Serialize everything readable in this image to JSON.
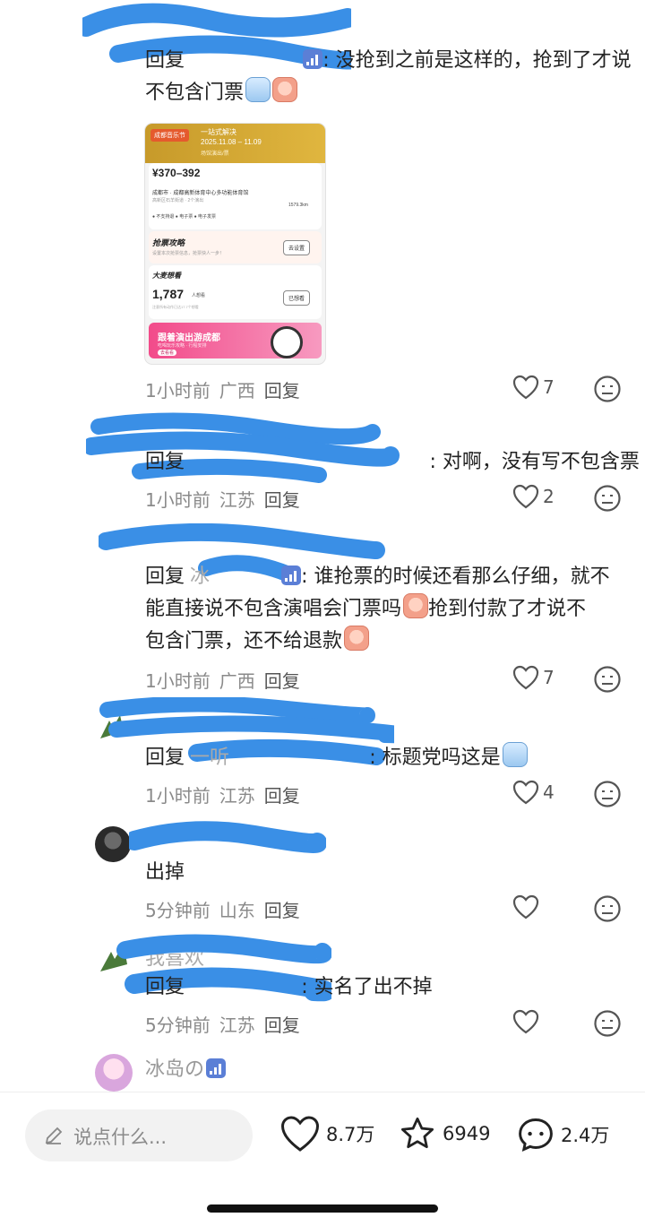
{
  "comments": [
    {
      "reply_prefix": "回复",
      "text": ": 没抢到之前是这样的，抢到了才说",
      "text2": "不包含门票",
      "time": "1小时前",
      "location": "广西",
      "reply_label": "回复",
      "likes": "7"
    },
    {
      "reply_prefix": "回复",
      "text": ": 对啊，没有写不包含票",
      "time": "1小时前",
      "location": "江苏",
      "reply_label": "回复",
      "likes": "2"
    },
    {
      "reply_prefix": "回复",
      "name_partial": "冰",
      "text": ": 谁抢票的时候还看那么仔细，就不",
      "text2": "能直接说不包含演唱会门票吗",
      "text2b": "抢到付款了才说不",
      "text3": "包含门票，还不给退款",
      "time": "1小时前",
      "location": "广西",
      "reply_label": "回复",
      "likes": "7"
    },
    {
      "reply_prefix": "回复",
      "name_partial": "一听",
      "text": ": 标题党吗这是",
      "time": "1小时前",
      "location": "江苏",
      "reply_label": "回复",
      "likes": "4"
    },
    {
      "text": "出掉",
      "time": "5分钟前",
      "location": "山东",
      "reply_label": "回复",
      "likes": ""
    },
    {
      "username_partial": "我喜欢",
      "reply_prefix": "回复",
      "text": ": 实名了出不掉",
      "time": "5分钟前",
      "location": "江苏",
      "reply_label": "回复",
      "likes": ""
    }
  ],
  "last_user": {
    "name": "冰岛の"
  },
  "ticket_card": {
    "logo": "成都音乐节",
    "headline": "一站式解决",
    "dates": "2025.11.08 – 11.09",
    "subline": "场馆演出/票",
    "price": "¥370–392",
    "venue": "成都市 · 成都高新体育中心多功能体育馆",
    "venue_sub": "高新区石羊街道 · 2个演出",
    "distance": "1579.3km",
    "tags": "● 不支持退   ● 电子票   ● 电子发票",
    "strategy_title": "抢票攻略",
    "strategy_sub": "设置本次抢票信息，抢票快人一步！",
    "strategy_btn": "去设置",
    "want_title": "大麦想看",
    "want_count": "1,787",
    "want_unit": "人想看",
    "want_note": "注意所有动作已达17.7个想看",
    "want_btn": "已想看",
    "banner_title": "跟着演出游成都",
    "banner_sub": "吃喝玩乐攻略 · 行程安排",
    "banner_btn": "去看看"
  },
  "bottom": {
    "input_placeholder": "说点什么...",
    "likes": "8.7万",
    "favorites": "6949",
    "comments": "2.4万"
  },
  "colors": {
    "scribble": "#3a8fe6",
    "meta_text": "#8a8a8a",
    "accent_pink": "#f24b8a"
  }
}
